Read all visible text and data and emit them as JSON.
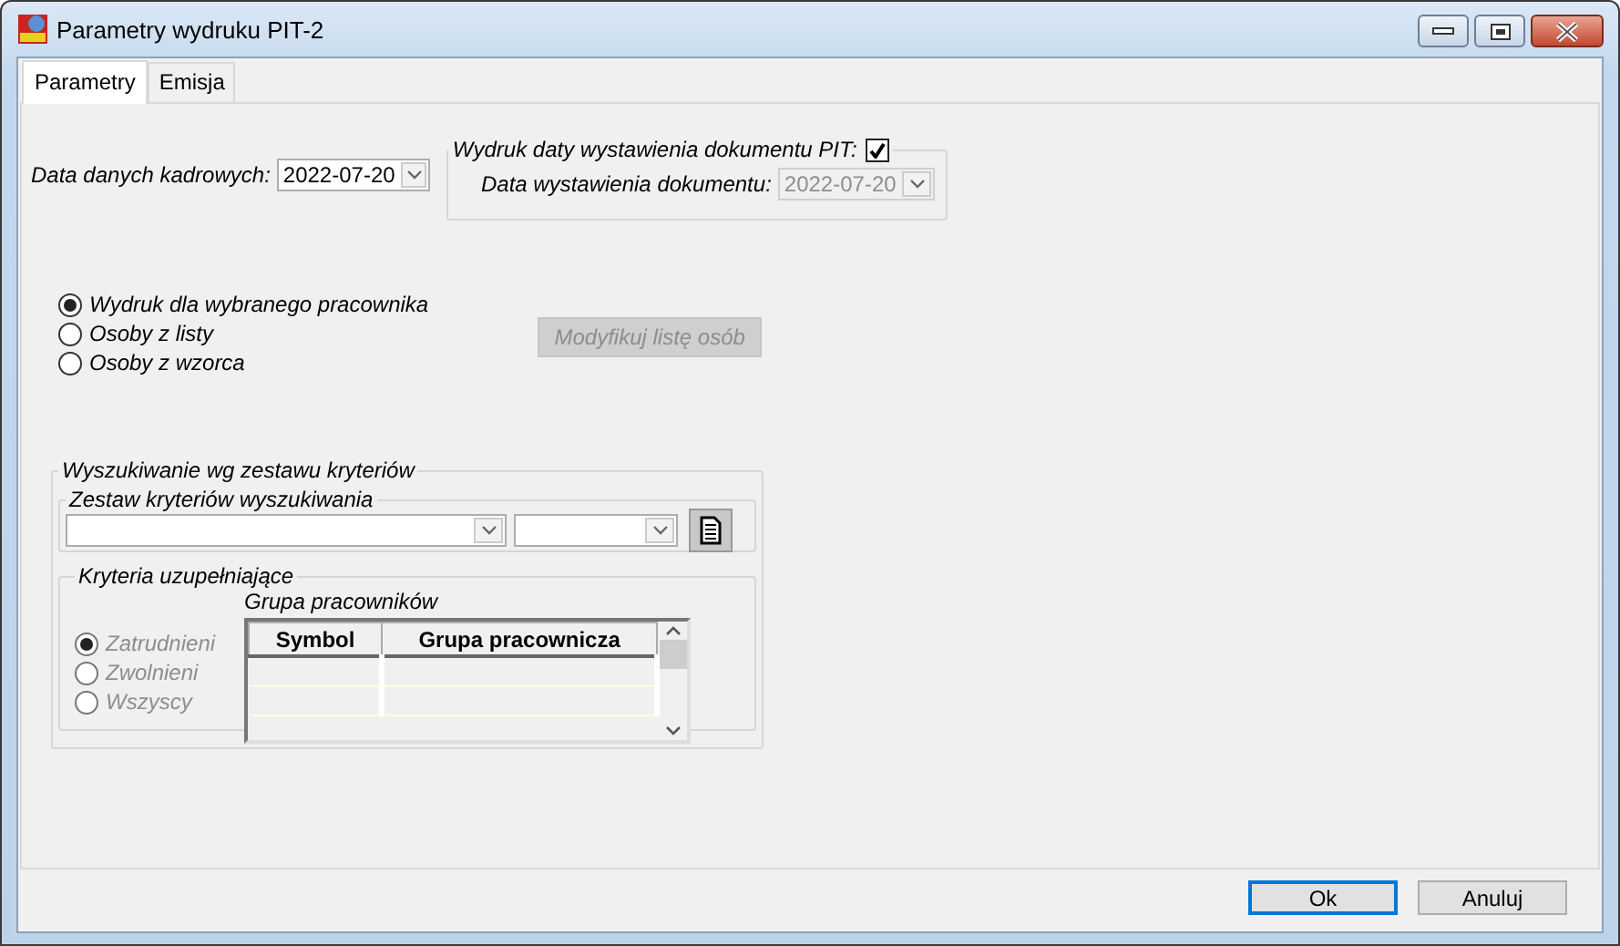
{
  "window": {
    "title": "Parametry wydruku PIT-2"
  },
  "tabs": [
    {
      "label": "Parametry",
      "selected": true
    },
    {
      "label": "Emisja",
      "selected": false
    }
  ],
  "data_kadrowych": {
    "label": "Data danych kadrowych:",
    "value": "2022-07-20"
  },
  "wydruk_daty": {
    "label": "Wydruk daty wystawienia dokumentu PIT:",
    "checked": true,
    "date_label": "Data wystawienia dokumentu:",
    "date_value": "2022-07-20",
    "date_disabled": true
  },
  "scope": [
    {
      "label": "Wydruk dla wybranego pracownika",
      "selected": true
    },
    {
      "label": "Osoby z listy",
      "selected": false
    },
    {
      "label": "Osoby z wzorca",
      "selected": false
    }
  ],
  "modify_button": {
    "label": "Modyfikuj listę osób",
    "disabled": true
  },
  "search_group": {
    "title": "Wyszukiwanie wg zestawu kryteriów",
    "criteria_set": {
      "title": "Zestaw kryteriów wyszukiwania"
    },
    "extra": {
      "title": "Kryteria uzupełniające",
      "status": [
        {
          "label": "Zatrudnieni",
          "selected": true,
          "disabled": true
        },
        {
          "label": "Zwolnieni",
          "selected": false,
          "disabled": true
        },
        {
          "label": "Wszyscy",
          "selected": false,
          "disabled": true
        }
      ],
      "grid": {
        "title": "Grupa pracowników",
        "columns": [
          "Symbol",
          "Grupa pracownicza"
        ]
      }
    }
  },
  "buttons": [
    {
      "label": "Ok",
      "default": true
    },
    {
      "label": "Anuluj",
      "default": false
    }
  ]
}
